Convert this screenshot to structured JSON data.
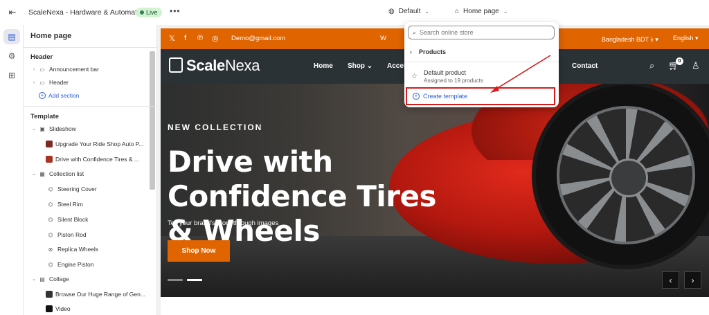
{
  "topbar": {
    "store_name": "ScaleNexa - Hardware & Automative",
    "status": "Live",
    "more": "•••",
    "theme": "Default",
    "page": "Home page"
  },
  "sidebar": {
    "title": "Home page",
    "header_section": "Header",
    "header_items": [
      "Announcement bar",
      "Header"
    ],
    "add_section": "Add section",
    "template_section": "Template",
    "tree": [
      {
        "label": "Slideshow",
        "level": 0,
        "expandable": true
      },
      {
        "label": "Upgrade Your Ride Shop Auto P...",
        "level": 1
      },
      {
        "label": "Drive with Confidence Tires & ...",
        "level": 1
      },
      {
        "label": "Collection list",
        "level": 0,
        "expandable": true
      },
      {
        "label": "Steering Cover",
        "level": 1
      },
      {
        "label": "Steel Rim",
        "level": 1
      },
      {
        "label": "Silent Block",
        "level": 1
      },
      {
        "label": "Piston Rod",
        "level": 1
      },
      {
        "label": "Replica Wheels",
        "level": 1
      },
      {
        "label": "Engine Piston",
        "level": 1
      },
      {
        "label": "Collage",
        "level": 0,
        "expandable": true
      },
      {
        "label": "Browse Our Huge Range of Gen...",
        "level": 1
      },
      {
        "label": "Video",
        "level": 1
      }
    ]
  },
  "preview": {
    "announcement": {
      "email": "Demo@gmail.com",
      "welcome": "W",
      "currency": "Bangladesh BDT ৳ ▾",
      "language": "English ▾"
    },
    "header": {
      "logo_bold": "Scale",
      "logo_light": "Nexa",
      "nav": [
        "Home",
        "Shop ⌄",
        "Access",
        "Contact"
      ],
      "cart_count": "0"
    },
    "hero": {
      "subtitle": "NEW COLLECTION",
      "title": "Drive with Confidence Tires & Wheels",
      "description": "Tell your brand's story through images",
      "button": "Shop Now"
    }
  },
  "dropdown": {
    "search_placeholder": "Search online store",
    "back_label": "Products",
    "item_name": "Default product",
    "item_sub": "Assigned to 19 products",
    "create_label": "Create template"
  },
  "colors": {
    "accent_orange": "#e06400",
    "nav_dark": "#2b3236",
    "link_blue": "#2b5fd9",
    "highlight_red": "#d81b1b"
  }
}
